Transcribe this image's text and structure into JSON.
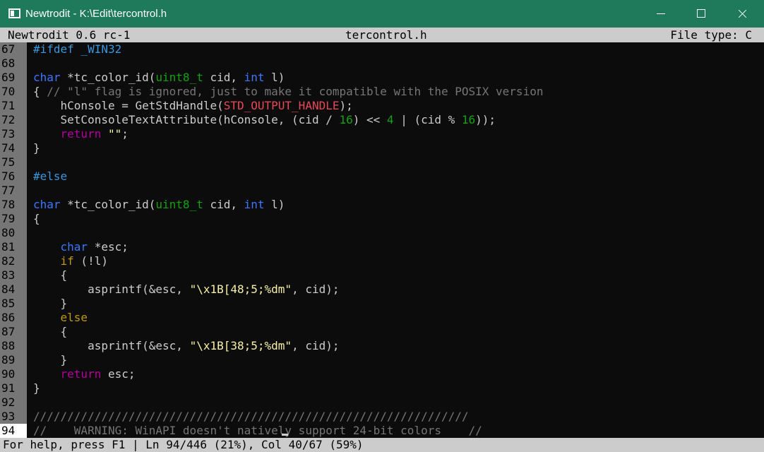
{
  "window": {
    "title": "Newtrodit - K:\\Edit\\tercontrol.h",
    "icons": {
      "app": "console-app-icon",
      "minimize": "minimize-icon",
      "maximize": "maximize-icon",
      "close": "close-icon"
    },
    "colors": {
      "titlebar": "#1e7a5a"
    }
  },
  "header": {
    "version": "Newtrodit 0.6 rc-1",
    "filename": "tercontrol.h",
    "filetype": "File type: C"
  },
  "editor": {
    "current_line": "94",
    "lines": [
      {
        "n": "67",
        "t": "#ifdef _WIN32"
      },
      {
        "n": "68",
        "t": ""
      },
      {
        "n": "69",
        "t": "char *tc_color_id(uint8_t cid, int l)"
      },
      {
        "n": "70",
        "t": "{ // \"l\" flag is ignored, just to make it compatible with the POSIX version"
      },
      {
        "n": "71",
        "t": "    hConsole = GetStdHandle(STD_OUTPUT_HANDLE);"
      },
      {
        "n": "72",
        "t": "    SetConsoleTextAttribute(hConsole, (cid / 16) << 4 | (cid % 16));"
      },
      {
        "n": "73",
        "t": "    return \"\";"
      },
      {
        "n": "74",
        "t": "}"
      },
      {
        "n": "75",
        "t": ""
      },
      {
        "n": "76",
        "t": "#else"
      },
      {
        "n": "77",
        "t": ""
      },
      {
        "n": "78",
        "t": "char *tc_color_id(uint8_t cid, int l)"
      },
      {
        "n": "79",
        "t": "{"
      },
      {
        "n": "80",
        "t": ""
      },
      {
        "n": "81",
        "t": "    char *esc;"
      },
      {
        "n": "82",
        "t": "    if (!l)"
      },
      {
        "n": "83",
        "t": "    {"
      },
      {
        "n": "84",
        "t": "        asprintf(&esc, \"\\x1B[48;5;%dm\", cid);"
      },
      {
        "n": "85",
        "t": "    }"
      },
      {
        "n": "86",
        "t": "    else"
      },
      {
        "n": "87",
        "t": "    {"
      },
      {
        "n": "88",
        "t": "        asprintf(&esc, \"\\x1B[38;5;%dm\", cid);"
      },
      {
        "n": "89",
        "t": "    }"
      },
      {
        "n": "90",
        "t": "    return esc;"
      },
      {
        "n": "91",
        "t": "}"
      },
      {
        "n": "92",
        "t": ""
      },
      {
        "n": "93",
        "t": "////////////////////////////////////////////////////////////////"
      },
      {
        "n": "94",
        "t": "//    WARNING: WinAPI doesn't natively support 24-bit colors    //"
      }
    ]
  },
  "status": {
    "text": "For help, press F1 | Ln 94/446 (21%), Col 40/67 (59%)"
  }
}
